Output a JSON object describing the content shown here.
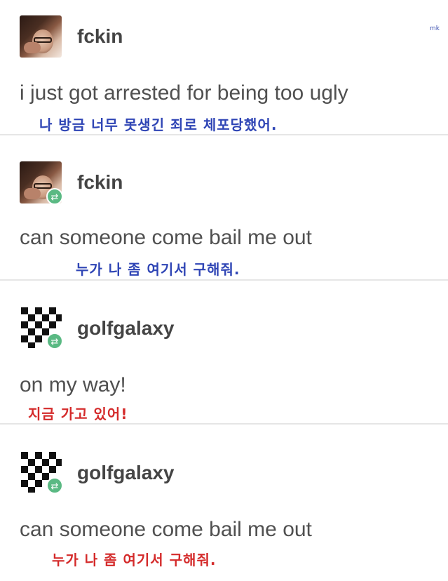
{
  "watermark": "mk",
  "colors": {
    "translation_blue": "#2f45b5",
    "translation_red": "#d42a2a",
    "reblog_badge": "#5ab983",
    "text": "#505050",
    "divider": "#e6e6e6"
  },
  "posts": [
    {
      "username": "fckin",
      "avatar_icon": "photo-avatar",
      "reblog": false,
      "message": "i just got arrested for being too ugly",
      "translation": "나 방금 너무 못생긴 죄로 체포당했어."
    },
    {
      "username": "fckin",
      "avatar_icon": "photo-avatar",
      "reblog": true,
      "message": "can someone come bail me out",
      "translation": "누가 나 좀 여기서 구해줘."
    },
    {
      "username": "golfgalaxy",
      "avatar_icon": "checkerboard-avatar",
      "reblog": true,
      "message": "on my way!",
      "translation": "지금 가고 있어!"
    },
    {
      "username": "golfgalaxy",
      "avatar_icon": "checkerboard-avatar",
      "reblog": true,
      "message": "can someone come bail me out",
      "translation": "누가 나 좀 여기서 구해줘."
    }
  ]
}
